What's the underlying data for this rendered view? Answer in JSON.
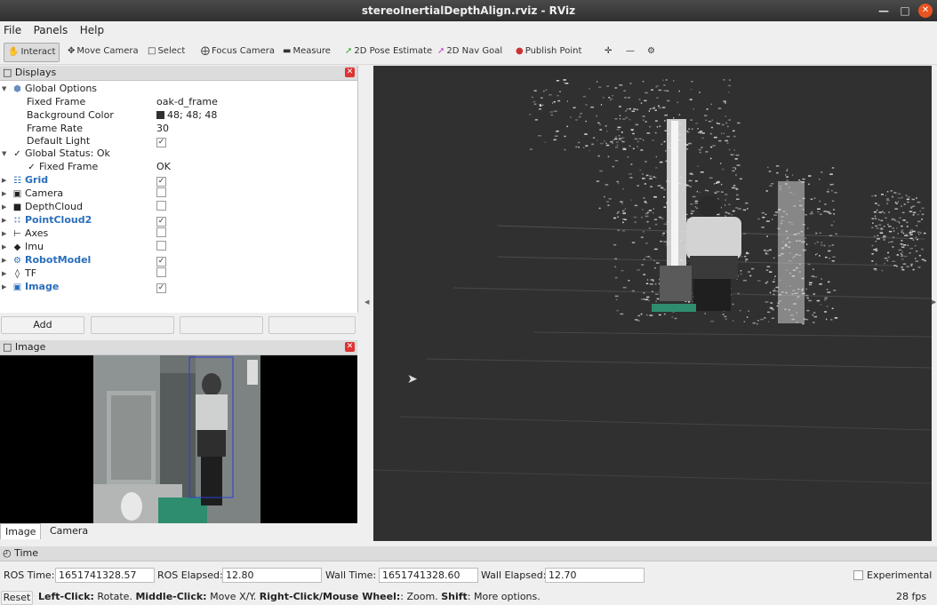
{
  "window": {
    "title": "stereoInertialDepthAlign.rviz - RViz"
  },
  "menu": [
    "File",
    "Panels",
    "Help"
  ],
  "toolbar": [
    {
      "label": "Interact",
      "icon": "interact-icon"
    },
    {
      "label": "Move Camera",
      "icon": "move-camera-icon"
    },
    {
      "label": "Select",
      "icon": "select-icon"
    },
    {
      "label": "Focus Camera",
      "icon": "focus-camera-icon"
    },
    {
      "label": "Measure",
      "icon": "measure-icon"
    },
    {
      "label": "2D Pose Estimate",
      "icon": "pose-estimate-icon"
    },
    {
      "label": "2D Nav Goal",
      "icon": "nav-goal-icon"
    },
    {
      "label": "Publish Point",
      "icon": "publish-point-icon"
    }
  ],
  "displays": {
    "title": "Displays",
    "global_options": "Global Options",
    "fixed_frame_label": "Fixed Frame",
    "fixed_frame_value": "oak-d_frame",
    "bg_color_label": "Background Color",
    "bg_color_value": "48; 48; 48",
    "bg_color_hex": "#303030",
    "frame_rate_label": "Frame Rate",
    "frame_rate_value": "30",
    "default_light_label": "Default Light",
    "global_status": "Global Status: Ok",
    "status_fixed_frame_label": "Fixed Frame",
    "status_fixed_frame_value": "OK",
    "items": [
      {
        "label": "Grid",
        "blue": true,
        "checked": true
      },
      {
        "label": "Camera",
        "blue": false,
        "checked": false
      },
      {
        "label": "DepthCloud",
        "blue": false,
        "checked": false
      },
      {
        "label": "PointCloud2",
        "blue": true,
        "checked": true
      },
      {
        "label": "Axes",
        "blue": false,
        "checked": false
      },
      {
        "label": "Imu",
        "blue": false,
        "checked": false
      },
      {
        "label": "RobotModel",
        "blue": true,
        "checked": true
      },
      {
        "label": "TF",
        "blue": false,
        "checked": false
      },
      {
        "label": "Image",
        "blue": true,
        "checked": true
      }
    ],
    "add_button": "Add"
  },
  "image_panel": {
    "title": "Image",
    "tabs": [
      "Image",
      "Camera"
    ]
  },
  "time_panel": {
    "title": "Time",
    "ros_time_label": "ROS Time:",
    "ros_time": "1651741328.57",
    "ros_elapsed_label": "ROS Elapsed:",
    "ros_elapsed": "12.80",
    "wall_time_label": "Wall Time:",
    "wall_time": "1651741328.60",
    "wall_elapsed_label": "Wall Elapsed:",
    "wall_elapsed": "12.70",
    "experimental_label": "Experimental"
  },
  "status_bar": {
    "reset": "Reset",
    "hint_1b": "Left-Click:",
    "hint_1": " Rotate. ",
    "hint_2b": "Middle-Click:",
    "hint_2": " Move X/Y. ",
    "hint_3b": "Right-Click/Mouse Wheel:",
    "hint_3": ": Zoom. ",
    "hint_4b": "Shift",
    "hint_4": ": More options.",
    "fps": "28 fps"
  }
}
